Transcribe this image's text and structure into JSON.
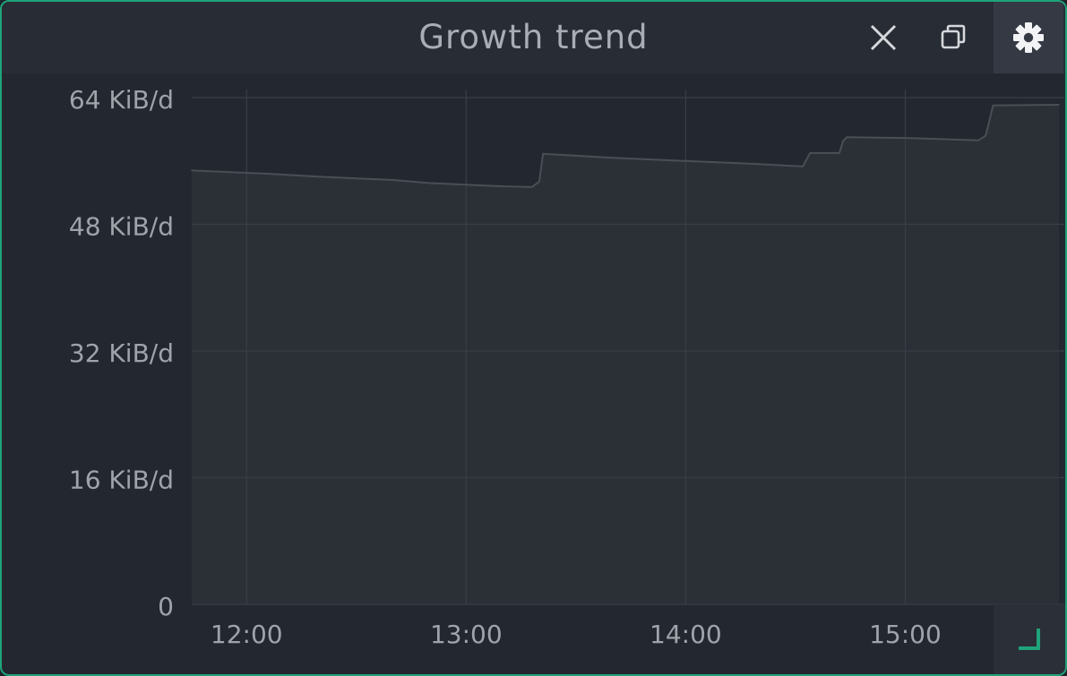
{
  "panel": {
    "title": "Growth trend",
    "accent_color": "#1fa37a",
    "buttons": {
      "close_icon": "close-icon",
      "copy_icon": "copy-icon",
      "settings_icon": "gear-icon",
      "resize_icon": "resize-corner-icon"
    }
  },
  "chart_data": {
    "type": "area",
    "title": "Growth trend",
    "xlabel": "",
    "ylabel": "",
    "x_ticks": [
      "12:00",
      "13:00",
      "14:00",
      "15:00"
    ],
    "y_ticks": [
      "0",
      "16 KiB/d",
      "32 KiB/d",
      "48 KiB/d",
      "64 KiB/d"
    ],
    "y_unit": "KiB/d",
    "ylim": [
      0,
      64
    ],
    "xlim": [
      "11:45",
      "15:42"
    ],
    "grid": true,
    "legend": "none",
    "series_color": "#3a3e44",
    "series": [
      {
        "points": [
          [
            "11:45",
            54.8
          ],
          [
            "12:05",
            54.4
          ],
          [
            "12:20",
            54.0
          ],
          [
            "12:40",
            53.6
          ],
          [
            "12:50",
            53.2
          ],
          [
            "13:10",
            52.8
          ],
          [
            "13:18",
            52.7
          ],
          [
            "13:20",
            53.4
          ],
          [
            "13:21",
            56.9
          ],
          [
            "13:40",
            56.4
          ],
          [
            "14:00",
            56.0
          ],
          [
            "14:20",
            55.6
          ],
          [
            "14:32",
            55.3
          ],
          [
            "14:34",
            57.0
          ],
          [
            "14:42",
            57.0
          ],
          [
            "14:43",
            58.5
          ],
          [
            "14:44",
            59.0
          ],
          [
            "15:00",
            58.9
          ],
          [
            "15:20",
            58.6
          ],
          [
            "15:22",
            59.2
          ],
          [
            "15:24",
            63.0
          ],
          [
            "15:42",
            63.1
          ]
        ]
      }
    ]
  }
}
